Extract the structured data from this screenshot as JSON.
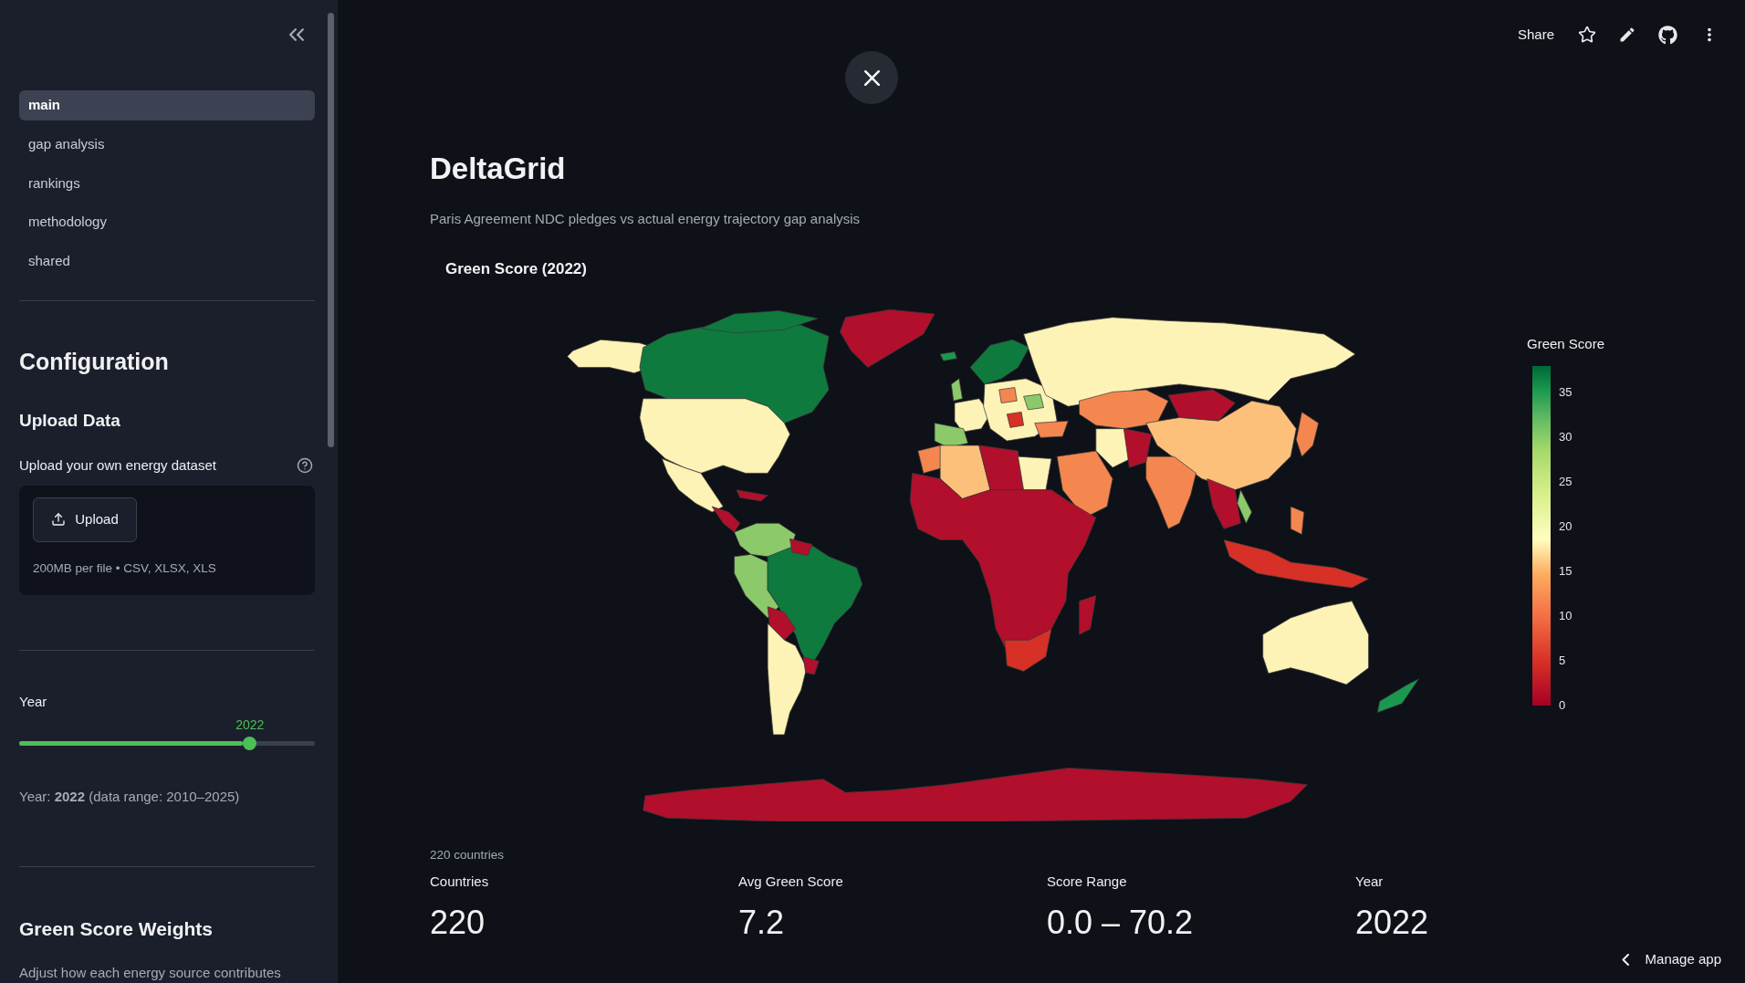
{
  "sidebar": {
    "nav": [
      {
        "label": "main",
        "selected": true
      },
      {
        "label": "gap analysis",
        "selected": false
      },
      {
        "label": "rankings",
        "selected": false
      },
      {
        "label": "methodology",
        "selected": false
      },
      {
        "label": "shared",
        "selected": false
      }
    ],
    "configuration": {
      "title": "Configuration",
      "upload": {
        "heading": "Upload Data",
        "label": "Upload your own energy dataset",
        "button": "Upload",
        "caption": "200MB per file • CSV, XLSX, XLS"
      },
      "year": {
        "label": "Year",
        "value": "2022",
        "level": 0.78,
        "note": "Year: **2022** (data range: 2010–2025)"
      },
      "weights": {
        "heading": "Green Score Weights",
        "description": "Adjust how each energy source contributes"
      }
    }
  },
  "toolbar": {
    "share": "Share"
  },
  "main": {
    "title": "DeltaGrid",
    "subtitle": "Paris Agreement NDC pledges vs actual energy trajectory gap analysis",
    "map": {
      "title": "Green Score (2022)",
      "colorbar": {
        "title": "Green Score",
        "ticks": [
          "35",
          "30",
          "25",
          "20",
          "15",
          "10",
          "5",
          "0"
        ]
      }
    },
    "caption": "220 countries",
    "metrics": [
      {
        "label": "Countries",
        "value": "220"
      },
      {
        "label": "Avg Green Score",
        "value": "7.2"
      },
      {
        "label": "Score Range",
        "value": "0.0 – 70.2"
      },
      {
        "label": "Year",
        "value": "2022"
      }
    ]
  },
  "manage_app": {
    "label": "Manage app"
  }
}
